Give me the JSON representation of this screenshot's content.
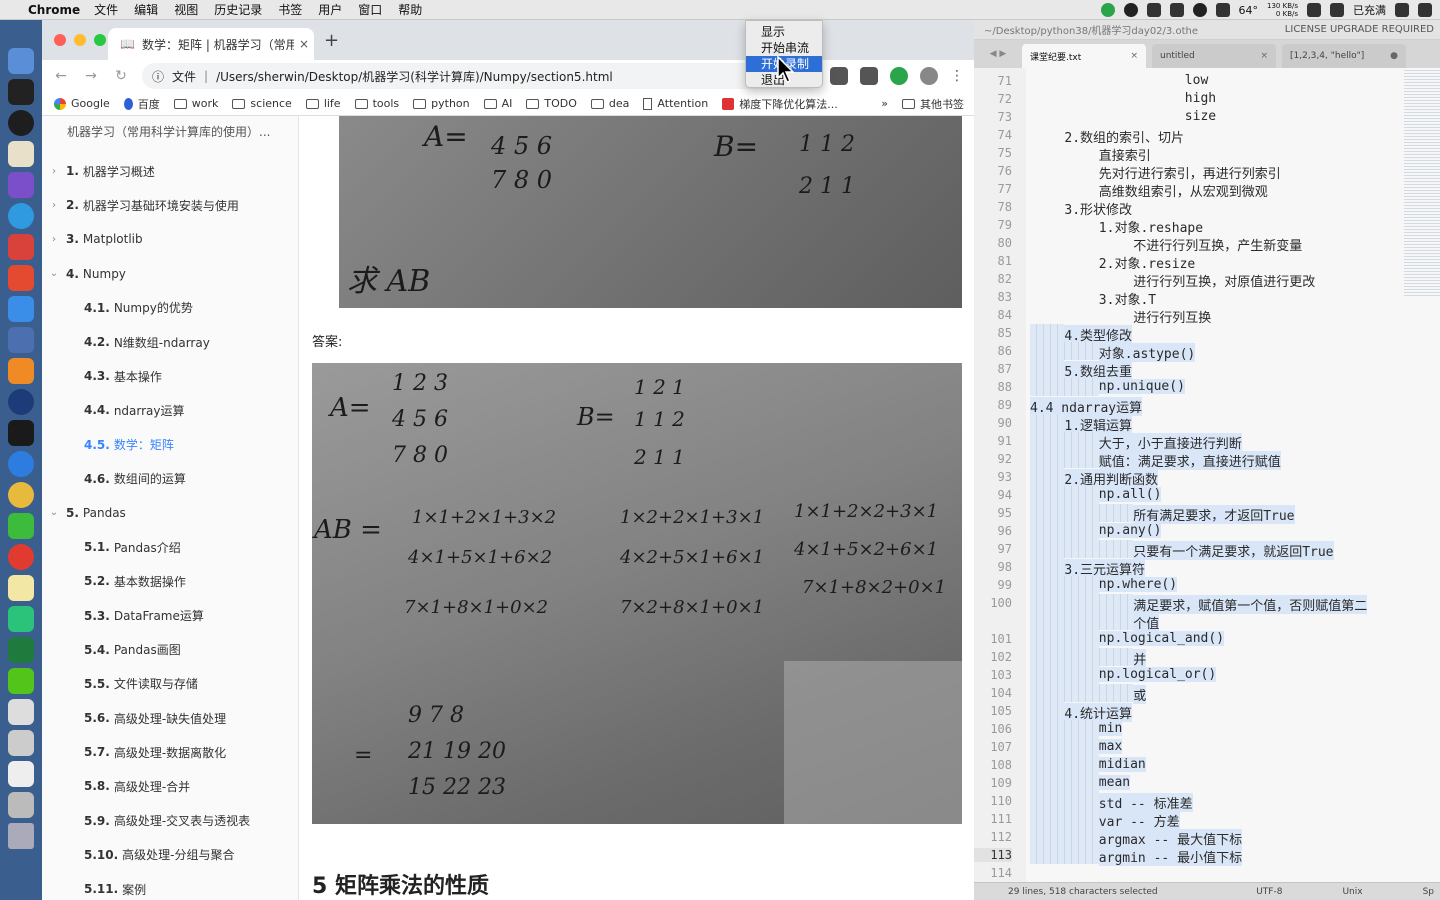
{
  "menubar": {
    "app_name": "Chrome",
    "items": [
      "文件",
      "编辑",
      "视图",
      "历史记录",
      "书签",
      "用户",
      "窗口",
      "帮助"
    ],
    "temperature": "64°",
    "net_up": "130 KB/s",
    "net_down": "0 KB/s",
    "battery": "已充满"
  },
  "tray_menu": {
    "items": [
      "显示",
      "开始串流",
      "开始录制",
      "退出"
    ],
    "highlighted_index": 2
  },
  "browser": {
    "tab_title": "数学：矩阵 | 机器学习（常用科",
    "url_scheme": "文件",
    "url": "/Users/sherwin/Desktop/机器学习(科学计算库)/Numpy/section5.html",
    "bookmarks": [
      "Google",
      "百度",
      "work",
      "science",
      "life",
      "tools",
      "python",
      "AI",
      "TODO",
      "dea",
      "Attention",
      "梯度下降优化算法..."
    ],
    "bookmarks_more": "»",
    "other_bookmarks": "其他书签"
  },
  "sidebar": {
    "book_title": "机器学习（常用科学计算库的使用）...",
    "items": [
      {
        "num": "1.",
        "label": "机器学习概述",
        "chev": "›"
      },
      {
        "num": "2.",
        "label": "机器学习基础环境安装与使用",
        "chev": "›"
      },
      {
        "num": "3.",
        "label": "Matplotlib",
        "chev": "›"
      },
      {
        "num": "4.",
        "label": "Numpy",
        "chev": "⌄"
      },
      {
        "num": "4.1.",
        "label": "Numpy的优势"
      },
      {
        "num": "4.2.",
        "label": "N维数组-ndarray"
      },
      {
        "num": "4.3.",
        "label": "基本操作"
      },
      {
        "num": "4.4.",
        "label": "ndarray运算"
      },
      {
        "num": "4.5.",
        "label": "数学：矩阵"
      },
      {
        "num": "4.6.",
        "label": "数组间的运算"
      },
      {
        "num": "5.",
        "label": "Pandas",
        "chev": "⌄"
      },
      {
        "num": "5.1.",
        "label": "Pandas介绍"
      },
      {
        "num": "5.2.",
        "label": "基本数据操作"
      },
      {
        "num": "5.3.",
        "label": "DataFrame运算"
      },
      {
        "num": "5.4.",
        "label": "Pandas画图"
      },
      {
        "num": "5.5.",
        "label": "文件读取与存储"
      },
      {
        "num": "5.6.",
        "label": "高级处理-缺失值处理"
      },
      {
        "num": "5.7.",
        "label": "高级处理-数据离散化"
      },
      {
        "num": "5.8.",
        "label": "高级处理-合并"
      },
      {
        "num": "5.9.",
        "label": "高级处理-交叉表与透视表"
      },
      {
        "num": "5.10.",
        "label": "高级处理-分组与聚合"
      },
      {
        "num": "5.11.",
        "label": "案例"
      }
    ]
  },
  "page": {
    "question_A": "A=",
    "question_A_row1": "4   5   6",
    "question_A_row2": "7   8   0",
    "question_B": "B=",
    "question_B_row1": "1   1   2",
    "question_B_row2": "2   1   1",
    "question_text": "求 AB",
    "answer_label": "答案:",
    "ans_A": "A=",
    "ans_A_rows": [
      "1   2   3",
      "4   5   6",
      "7   8   0"
    ],
    "ans_B": "B=",
    "ans_B_rows": [
      "1   2   1",
      "1   1   2",
      "2   1   1"
    ],
    "ab_label": "AB =",
    "ab_rows": [
      [
        "1×1+2×1+3×2",
        "1×2+2×1+3×1",
        "1×1+2×2+3×1"
      ],
      [
        "4×1+5×1+6×2",
        "4×2+5×1+6×1",
        "4×1+5×2+6×1"
      ],
      [
        "7×1+8×1+0×2",
        "7×2+8×1+0×1",
        "7×1+8×2+0×1"
      ]
    ],
    "result_eq": "=",
    "result_rows": [
      "9    7    8",
      "21   19   20",
      "15   22   23"
    ],
    "section_heading": "5 矩阵乘法的性质"
  },
  "editor": {
    "title_path": "~/Desktop/python38/机器学习day02/3.othe",
    "license": "LICENSE UPGRADE REQUIRED",
    "tabs": [
      {
        "label": "课堂纪要.txt",
        "close": "×"
      },
      {
        "label": "untitled",
        "close": "×"
      },
      {
        "label": "[1,2,3,4, \"hello\"]",
        "close": "●"
      }
    ],
    "lines": [
      {
        "n": "71",
        "t": "                  low",
        "sel": false
      },
      {
        "n": "72",
        "t": "                  high",
        "sel": false
      },
      {
        "n": "73",
        "t": "                  size",
        "sel": false
      },
      {
        "n": "74",
        "t": "    2.数组的索引、切片",
        "sel": false
      },
      {
        "n": "75",
        "t": "        直接索引",
        "sel": false
      },
      {
        "n": "76",
        "t": "        先对行进行索引，再进行列索引",
        "sel": false
      },
      {
        "n": "77",
        "t": "        高维数组索引，从宏观到微观",
        "sel": false
      },
      {
        "n": "78",
        "t": "    3.形状修改",
        "sel": false
      },
      {
        "n": "79",
        "t": "        1.对象.reshape",
        "sel": false
      },
      {
        "n": "80",
        "t": "            不进行行列互换，产生新变量",
        "sel": false
      },
      {
        "n": "81",
        "t": "        2.对象.resize",
        "sel": false
      },
      {
        "n": "82",
        "t": "            进行行列互换，对原值进行更改",
        "sel": false
      },
      {
        "n": "83",
        "t": "        3.对象.T",
        "sel": false
      },
      {
        "n": "84",
        "t": "            进行行列互换",
        "sel": false
      },
      {
        "n": "85",
        "t": "    4.类型修改",
        "sel": true
      },
      {
        "n": "86",
        "t": "        对象.astype()",
        "sel": true
      },
      {
        "n": "87",
        "t": "    5.数组去重",
        "sel": true
      },
      {
        "n": "88",
        "t": "        np.unique()",
        "sel": true
      },
      {
        "n": "89",
        "t": "4.4 ndarray运算",
        "sel": true
      },
      {
        "n": "90",
        "t": "    1.逻辑运算",
        "sel": true
      },
      {
        "n": "91",
        "t": "        大于，小于直接进行判断",
        "sel": true
      },
      {
        "n": "92",
        "t": "        赋值：满足要求，直接进行赋值",
        "sel": true
      },
      {
        "n": "93",
        "t": "    2.通用判断函数",
        "sel": true
      },
      {
        "n": "94",
        "t": "        np.all()",
        "sel": true
      },
      {
        "n": "95",
        "t": "            所有满足要求，才返回True",
        "sel": true
      },
      {
        "n": "96",
        "t": "        np.any()",
        "sel": true
      },
      {
        "n": "97",
        "t": "            只要有一个满足要求，就返回True",
        "sel": true
      },
      {
        "n": "98",
        "t": "    3.三元运算符",
        "sel": true
      },
      {
        "n": "99",
        "t": "        np.where()",
        "sel": true
      },
      {
        "n": "100",
        "t": "            满足要求，赋值第一个值，否则赋值第二",
        "sel": true
      },
      {
        "n": "",
        "t": "            个值",
        "sel": true
      },
      {
        "n": "101",
        "t": "        np.logical_and()",
        "sel": true
      },
      {
        "n": "102",
        "t": "            并",
        "sel": true
      },
      {
        "n": "103",
        "t": "        np.logical_or()",
        "sel": true
      },
      {
        "n": "104",
        "t": "            或",
        "sel": true
      },
      {
        "n": "105",
        "t": "    4.统计运算",
        "sel": true
      },
      {
        "n": "106",
        "t": "        min",
        "sel": true
      },
      {
        "n": "107",
        "t": "        max",
        "sel": true
      },
      {
        "n": "108",
        "t": "        midian",
        "sel": true
      },
      {
        "n": "109",
        "t": "        mean",
        "sel": true
      },
      {
        "n": "110",
        "t": "        std -- 标准差",
        "sel": true
      },
      {
        "n": "111",
        "t": "        var -- 方差",
        "sel": true
      },
      {
        "n": "112",
        "t": "        argmax -- 最大值下标",
        "sel": true
      },
      {
        "n": "113",
        "t": "        argmin -- 最小值下标",
        "sel": true,
        "cur": true
      },
      {
        "n": "114",
        "t": "",
        "sel": false
      }
    ],
    "status_selection": "29 lines, 518 characters selected",
    "status_encoding": "UTF-8",
    "status_line_endings": "Unix",
    "status_spaces": "Sp"
  }
}
